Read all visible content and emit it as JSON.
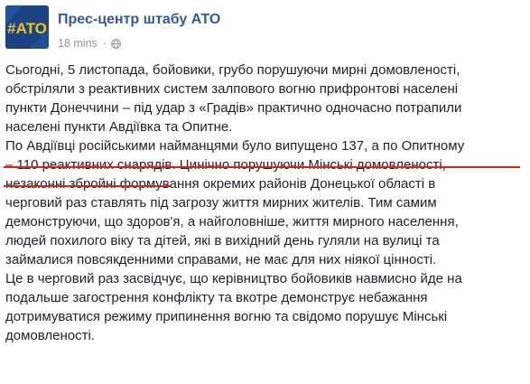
{
  "post": {
    "page_name": "Прес-центр штабу АТО",
    "avatar_text": "#ATO",
    "timestamp": "18 mins",
    "separator": "·",
    "privacy_icon": "globe-icon",
    "paragraphs": [
      [
        "Сьогодні, 5 листопада, бойовики, грубо порушуючи мирні домовленості,",
        "обстріляли з реактивних систем залпового вогню прифронтові населені",
        "пункти Донеччини – під удар з «Градів» практично одночасно потрапили",
        "населені пункти Авдіївка та Опитне."
      ],
      [
        "По Авдіївці російськими найманцями було випущено 137, а по Опитному",
        "– 110 реактивних снарядів.",
        " Цинічно порушуючи Мінські домовленості,",
        "незаконні збройні формування окремих районів Донецької області в",
        "черговий раз ставлять під загрозу життя мирних жителів. Тим самим",
        "демонструючи, що здоров'я, а найголовніше, життя мирного населення,",
        "людей похилого віку та дітей, які в вихідний день гуляли на вулиці та",
        "займалися повсякденними справами, не має для них ніякої цінності."
      ],
      [
        "Це в черговий раз засвідчує, що керівництво бойовиків навмисно йде на",
        "подальше загострення конфлікту та вкотре демонструє небажання",
        "дотримуватися режиму припинення вогню та свідомо порушує Мінські",
        "домовленості."
      ]
    ]
  },
  "colors": {
    "link_blue": "#365899",
    "meta_grey": "#90949c",
    "text": "#1d2129",
    "highlight_red": "#d9241c",
    "avatar_bg": "#1f4a8f",
    "avatar_accent": "#f3c316"
  }
}
